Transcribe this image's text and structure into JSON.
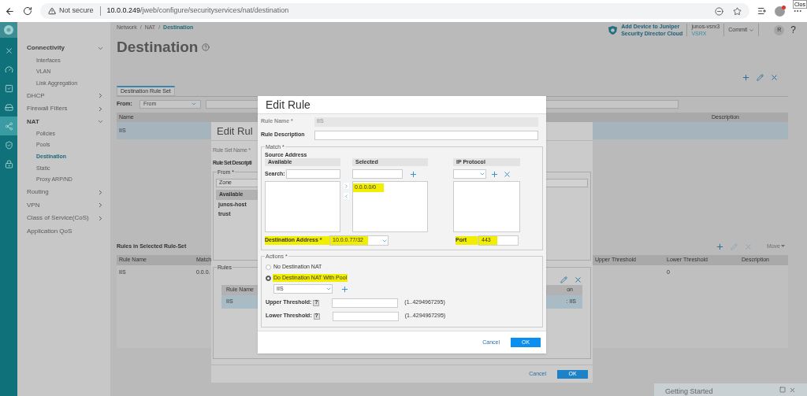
{
  "browser": {
    "security": "Not secure",
    "url_host": "10.0.0.249",
    "url_path": "/jweb/configure/securityservices/nat/destination",
    "tooltip": "Clos"
  },
  "rail": [
    {
      "kind": "x",
      "selected": false
    },
    {
      "kind": "gauge",
      "selected": false
    },
    {
      "kind": "check",
      "selected": false
    },
    {
      "kind": "rack",
      "selected": false
    },
    {
      "kind": "network",
      "selected": true
    },
    {
      "kind": "shield",
      "selected": false
    },
    {
      "kind": "lock",
      "selected": false
    }
  ],
  "sidebar": {
    "items": [
      {
        "label": "Connectivity",
        "expanded": true,
        "children": [
          {
            "label": "Interfaces",
            "selected": false
          },
          {
            "label": "VLAN",
            "selected": false
          },
          {
            "label": "Link Aggregation",
            "selected": false
          }
        ]
      },
      {
        "label": "DHCP",
        "expanded": false
      },
      {
        "label": "Firewall Filters",
        "expanded": false
      },
      {
        "label": "NAT",
        "expanded": true,
        "children": [
          {
            "label": "Policies",
            "selected": false
          },
          {
            "label": "Pools",
            "selected": false
          },
          {
            "label": "Destination",
            "selected": true
          },
          {
            "label": "Static",
            "selected": false
          },
          {
            "label": "Proxy ARP/ND",
            "selected": false
          }
        ]
      },
      {
        "label": "Routing",
        "expanded": false
      },
      {
        "label": "VPN",
        "expanded": false
      },
      {
        "label": "Class of Service(CoS)",
        "expanded": false
      },
      {
        "label": "Application QoS"
      }
    ]
  },
  "header": {
    "breadcrumb": [
      {
        "label": "Network",
        "selected": false
      },
      {
        "label": "NAT",
        "selected": false
      },
      {
        "label": "Destination",
        "selected": true
      }
    ],
    "separator": "/",
    "promo": [
      "Add Device to Juniper",
      "Security Director Cloud"
    ],
    "device": "junos-vsrx3",
    "model": "VSRX",
    "commit": "Commit",
    "avatar": "R",
    "help": "?"
  },
  "page": {
    "title": "Destination",
    "tab": {
      "label": "Destination Rule Set",
      "selected": true
    },
    "from_label": "From:",
    "from_value": "From",
    "columns": [
      "Name",
      "Description"
    ],
    "rows": [
      {
        "name": "IIS",
        "selected": true
      }
    ]
  },
  "rules_section": {
    "title": "Rules in Selected Rule-Set",
    "move": "Move",
    "columns": [
      "Rule Name",
      "Match",
      "Upper Threshold",
      "Lower Threshold",
      "Description"
    ],
    "rows": [
      {
        "rule_name": "IIS",
        "match": "0.0.0.",
        "lower_threshold": "0"
      }
    ]
  },
  "rule_set_dialog": {
    "title": "Edit Rul",
    "name_label": "Rule Set Name *",
    "description_label": "Rule Set Descripti",
    "from_legend": "From *",
    "zone": "Zone",
    "available_header": "Available",
    "zones": [
      "junos-host",
      "trust"
    ],
    "rules_legend": "Rules",
    "rules_columns": [
      "Rule Name",
      "on"
    ],
    "rules_rows": [
      {
        "rule_name": "IIS",
        "column_2": ": IIS",
        "selected": true
      }
    ],
    "cancel": "Cancel",
    "ok": "OK"
  },
  "edit_rule_dialog": {
    "title": "Edit Rule",
    "rule_name_label": "Rule Name *",
    "rule_name_value": "IIS",
    "rule_description_label": "Rule Description",
    "match_legend": "Match *",
    "source_label": "Source Address",
    "available_header": "Available",
    "search_label": "Search:",
    "selected_header": "Selected",
    "selected_items": [
      {
        "text": "0.0.0.0/0",
        "highlighted": true
      }
    ],
    "ip_protocol_header": "IP Protocol",
    "destination": {
      "label": "Destination Address *",
      "value": "10.0.0.77/32",
      "highlighted": true
    },
    "port": {
      "label": "Port",
      "value": "443",
      "highlighted": true
    },
    "actions_legend": "Actions *",
    "actions": [
      {
        "label": "No Destination NAT",
        "selected": false,
        "highlighted": false
      },
      {
        "label": "Do Destination NAT With Pool",
        "selected": true,
        "highlighted": true
      }
    ],
    "pool": "IIS",
    "thresholds": [
      {
        "label": "Upper Threshold:",
        "help": "?",
        "range": "(1..4294967295)"
      },
      {
        "label": "Lower Threshold:",
        "help": "?",
        "range": "(1..4294967295)"
      }
    ],
    "cancel": "Cancel",
    "ok": "OK"
  },
  "getting_started": {
    "title": "Getting Started"
  }
}
